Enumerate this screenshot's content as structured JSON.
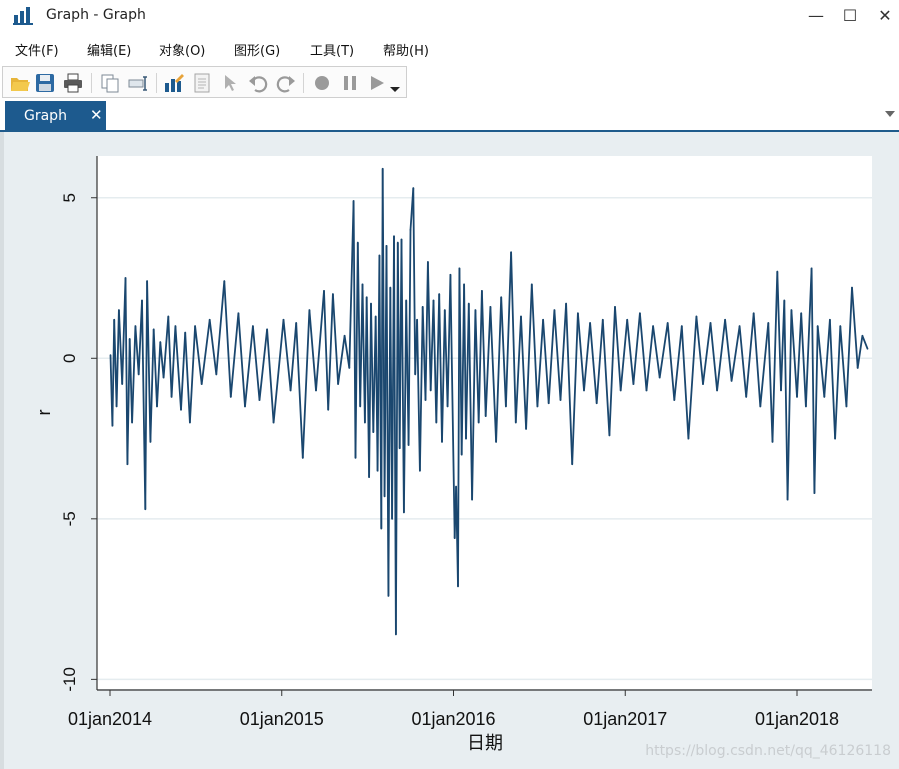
{
  "window": {
    "title": "Graph - Graph",
    "controls": {
      "minimize": "—",
      "maximize": "☐",
      "close": "✕"
    }
  },
  "menu": [
    "文件(F)",
    "编辑(E)",
    "对象(O)",
    "图形(G)",
    "工具(T)",
    "帮助(H)"
  ],
  "toolbar": {
    "icons": [
      "open-folder-icon",
      "save-icon",
      "print-icon",
      "copy-icon",
      "rename-icon",
      "graph-editor-icon",
      "document-icon",
      "pointer-icon",
      "undo-icon",
      "redo-icon",
      "record-icon",
      "pause-icon",
      "play-icon",
      "dropdown-icon"
    ]
  },
  "tab": {
    "label": "Graph",
    "close": "✕"
  },
  "watermark": "https://blog.csdn.net/qq_46126118",
  "colors": {
    "series": "#1a476f",
    "plot_bg": "#ffffff",
    "outer_bg": "#e8eef1",
    "tab_bg": "#1d5a8e",
    "grid": "#e5ecef"
  },
  "chart_data": {
    "type": "line",
    "xlabel": "日期",
    "ylabel": "r",
    "x_ticks": [
      "01jan2014",
      "01jan2015",
      "01jan2016",
      "01jan2017",
      "01jan2018"
    ],
    "y_ticks": [
      "-10",
      "-5",
      "0",
      "5"
    ],
    "ylim": [
      -10.3,
      6.3
    ],
    "x_range": [
      "2014-01-01",
      "2018-05-31"
    ],
    "grid": "horizontal",
    "series": [
      {
        "values": [
          {
            "x": "2014-01-02",
            "y": 0.1
          },
          {
            "x": "2014-01-06",
            "y": -2.1
          },
          {
            "x": "2014-01-10",
            "y": 1.2
          },
          {
            "x": "2014-01-15",
            "y": -1.5
          },
          {
            "x": "2014-01-20",
            "y": 1.5
          },
          {
            "x": "2014-01-27",
            "y": -0.8
          },
          {
            "x": "2014-02-03",
            "y": 2.5
          },
          {
            "x": "2014-02-07",
            "y": -3.3
          },
          {
            "x": "2014-02-12",
            "y": 0.6
          },
          {
            "x": "2014-02-17",
            "y": -2.0
          },
          {
            "x": "2014-02-24",
            "y": 1.0
          },
          {
            "x": "2014-03-03",
            "y": -0.5
          },
          {
            "x": "2014-03-10",
            "y": 1.8
          },
          {
            "x": "2014-03-17",
            "y": -4.7
          },
          {
            "x": "2014-03-21",
            "y": 2.4
          },
          {
            "x": "2014-03-28",
            "y": -2.6
          },
          {
            "x": "2014-04-04",
            "y": 0.9
          },
          {
            "x": "2014-04-11",
            "y": -1.5
          },
          {
            "x": "2014-04-18",
            "y": 0.5
          },
          {
            "x": "2014-04-25",
            "y": -0.6
          },
          {
            "x": "2014-05-05",
            "y": 1.3
          },
          {
            "x": "2014-05-12",
            "y": -1.2
          },
          {
            "x": "2014-05-20",
            "y": 1.0
          },
          {
            "x": "2014-06-01",
            "y": -1.6
          },
          {
            "x": "2014-06-10",
            "y": 0.8
          },
          {
            "x": "2014-06-20",
            "y": -2.0
          },
          {
            "x": "2014-07-01",
            "y": 1.0
          },
          {
            "x": "2014-07-15",
            "y": -0.8
          },
          {
            "x": "2014-08-01",
            "y": 1.2
          },
          {
            "x": "2014-08-15",
            "y": -0.5
          },
          {
            "x": "2014-09-01",
            "y": 2.4
          },
          {
            "x": "2014-09-15",
            "y": -1.2
          },
          {
            "x": "2014-10-01",
            "y": 1.4
          },
          {
            "x": "2014-10-15",
            "y": -1.5
          },
          {
            "x": "2014-11-01",
            "y": 1.0
          },
          {
            "x": "2014-11-15",
            "y": -1.3
          },
          {
            "x": "2014-12-01",
            "y": 0.9
          },
          {
            "x": "2014-12-15",
            "y": -2.0
          },
          {
            "x": "2015-01-05",
            "y": 1.2
          },
          {
            "x": "2015-01-20",
            "y": -1.0
          },
          {
            "x": "2015-02-01",
            "y": 1.1
          },
          {
            "x": "2015-02-15",
            "y": -3.1
          },
          {
            "x": "2015-03-01",
            "y": 1.5
          },
          {
            "x": "2015-03-15",
            "y": -1.0
          },
          {
            "x": "2015-04-01",
            "y": 2.1
          },
          {
            "x": "2015-04-10",
            "y": -1.6
          },
          {
            "x": "2015-04-20",
            "y": 2.0
          },
          {
            "x": "2015-05-01",
            "y": -0.8
          },
          {
            "x": "2015-05-15",
            "y": 0.7
          },
          {
            "x": "2015-05-25",
            "y": -0.3
          },
          {
            "x": "2015-06-03",
            "y": 4.9
          },
          {
            "x": "2015-06-07",
            "y": -3.1
          },
          {
            "x": "2015-06-12",
            "y": 3.6
          },
          {
            "x": "2015-06-17",
            "y": -1.5
          },
          {
            "x": "2015-06-22",
            "y": 2.3
          },
          {
            "x": "2015-06-27",
            "y": -2.0
          },
          {
            "x": "2015-07-01",
            "y": 1.9
          },
          {
            "x": "2015-07-06",
            "y": -3.7
          },
          {
            "x": "2015-07-10",
            "y": 1.7
          },
          {
            "x": "2015-07-15",
            "y": -2.3
          },
          {
            "x": "2015-07-20",
            "y": 1.3
          },
          {
            "x": "2015-07-24",
            "y": -3.5
          },
          {
            "x": "2015-07-28",
            "y": 3.2
          },
          {
            "x": "2015-08-01",
            "y": -5.3
          },
          {
            "x": "2015-08-04",
            "y": 5.9
          },
          {
            "x": "2015-08-08",
            "y": -4.3
          },
          {
            "x": "2015-08-12",
            "y": 3.5
          },
          {
            "x": "2015-08-16",
            "y": -7.4
          },
          {
            "x": "2015-08-20",
            "y": 2.2
          },
          {
            "x": "2015-08-24",
            "y": -5.0
          },
          {
            "x": "2015-08-28",
            "y": 3.8
          },
          {
            "x": "2015-09-01",
            "y": -8.6
          },
          {
            "x": "2015-09-05",
            "y": 3.6
          },
          {
            "x": "2015-09-09",
            "y": -2.8
          },
          {
            "x": "2015-09-13",
            "y": 3.7
          },
          {
            "x": "2015-09-18",
            "y": -4.8
          },
          {
            "x": "2015-09-23",
            "y": 1.8
          },
          {
            "x": "2015-09-28",
            "y": -2.7
          },
          {
            "x": "2015-10-02",
            "y": 4.0
          },
          {
            "x": "2015-10-08",
            "y": 5.3
          },
          {
            "x": "2015-10-12",
            "y": -0.5
          },
          {
            "x": "2015-10-16",
            "y": 1.2
          },
          {
            "x": "2015-10-22",
            "y": -3.5
          },
          {
            "x": "2015-10-28",
            "y": 1.6
          },
          {
            "x": "2015-11-03",
            "y": -1.3
          },
          {
            "x": "2015-11-08",
            "y": 3.0
          },
          {
            "x": "2015-11-14",
            "y": -1.0
          },
          {
            "x": "2015-11-20",
            "y": 1.8
          },
          {
            "x": "2015-11-26",
            "y": -2.0
          },
          {
            "x": "2015-12-02",
            "y": 2.0
          },
          {
            "x": "2015-12-08",
            "y": -2.6
          },
          {
            "x": "2015-12-14",
            "y": 1.5
          },
          {
            "x": "2015-12-20",
            "y": -1.5
          },
          {
            "x": "2015-12-26",
            "y": 2.6
          },
          {
            "x": "2016-01-04",
            "y": -5.6
          },
          {
            "x": "2016-01-07",
            "y": -4.0
          },
          {
            "x": "2016-01-11",
            "y": -7.1
          },
          {
            "x": "2016-01-14",
            "y": 2.8
          },
          {
            "x": "2016-01-19",
            "y": -3.0
          },
          {
            "x": "2016-01-24",
            "y": 2.3
          },
          {
            "x": "2016-01-28",
            "y": -2.5
          },
          {
            "x": "2016-02-03",
            "y": 1.7
          },
          {
            "x": "2016-02-10",
            "y": -4.4
          },
          {
            "x": "2016-02-17",
            "y": 1.5
          },
          {
            "x": "2016-02-24",
            "y": -2.0
          },
          {
            "x": "2016-03-02",
            "y": 2.1
          },
          {
            "x": "2016-03-10",
            "y": -1.8
          },
          {
            "x": "2016-03-20",
            "y": 1.6
          },
          {
            "x": "2016-04-01",
            "y": -2.6
          },
          {
            "x": "2016-04-12",
            "y": 1.9
          },
          {
            "x": "2016-04-22",
            "y": -1.5
          },
          {
            "x": "2016-05-03",
            "y": 3.3
          },
          {
            "x": "2016-05-13",
            "y": -2.0
          },
          {
            "x": "2016-05-24",
            "y": 1.3
          },
          {
            "x": "2016-06-04",
            "y": -2.2
          },
          {
            "x": "2016-06-16",
            "y": 2.3
          },
          {
            "x": "2016-06-28",
            "y": -1.5
          },
          {
            "x": "2016-07-10",
            "y": 1.2
          },
          {
            "x": "2016-07-22",
            "y": -1.4
          },
          {
            "x": "2016-08-03",
            "y": 1.5
          },
          {
            "x": "2016-08-16",
            "y": -1.3
          },
          {
            "x": "2016-08-28",
            "y": 1.7
          },
          {
            "x": "2016-09-10",
            "y": -3.3
          },
          {
            "x": "2016-09-22",
            "y": 1.4
          },
          {
            "x": "2016-10-05",
            "y": -1.0
          },
          {
            "x": "2016-10-18",
            "y": 1.1
          },
          {
            "x": "2016-11-01",
            "y": -1.4
          },
          {
            "x": "2016-11-14",
            "y": 1.2
          },
          {
            "x": "2016-11-28",
            "y": -2.4
          },
          {
            "x": "2016-12-10",
            "y": 1.6
          },
          {
            "x": "2016-12-22",
            "y": -1.0
          },
          {
            "x": "2017-01-05",
            "y": 1.2
          },
          {
            "x": "2017-01-18",
            "y": -0.8
          },
          {
            "x": "2017-02-01",
            "y": 1.4
          },
          {
            "x": "2017-02-15",
            "y": -1.0
          },
          {
            "x": "2017-03-01",
            "y": 1.0
          },
          {
            "x": "2017-03-15",
            "y": -0.6
          },
          {
            "x": "2017-04-01",
            "y": 1.1
          },
          {
            "x": "2017-04-15",
            "y": -1.3
          },
          {
            "x": "2017-05-01",
            "y": 1.0
          },
          {
            "x": "2017-05-15",
            "y": -2.5
          },
          {
            "x": "2017-06-01",
            "y": 1.3
          },
          {
            "x": "2017-06-15",
            "y": -0.8
          },
          {
            "x": "2017-07-01",
            "y": 1.1
          },
          {
            "x": "2017-07-15",
            "y": -1.0
          },
          {
            "x": "2017-08-01",
            "y": 1.2
          },
          {
            "x": "2017-08-15",
            "y": -0.7
          },
          {
            "x": "2017-09-01",
            "y": 1.0
          },
          {
            "x": "2017-09-15",
            "y": -1.2
          },
          {
            "x": "2017-10-01",
            "y": 1.4
          },
          {
            "x": "2017-10-15",
            "y": -1.5
          },
          {
            "x": "2017-11-01",
            "y": 1.1
          },
          {
            "x": "2017-11-10",
            "y": -2.6
          },
          {
            "x": "2017-11-20",
            "y": 2.7
          },
          {
            "x": "2017-11-28",
            "y": -1.0
          },
          {
            "x": "2017-12-05",
            "y": 1.8
          },
          {
            "x": "2017-12-12",
            "y": -4.4
          },
          {
            "x": "2017-12-20",
            "y": 1.5
          },
          {
            "x": "2018-01-01",
            "y": -1.2
          },
          {
            "x": "2018-01-10",
            "y": 1.4
          },
          {
            "x": "2018-01-20",
            "y": -1.5
          },
          {
            "x": "2018-02-01",
            "y": 2.8
          },
          {
            "x": "2018-02-07",
            "y": -4.2
          },
          {
            "x": "2018-02-14",
            "y": 1.0
          },
          {
            "x": "2018-02-28",
            "y": -1.2
          },
          {
            "x": "2018-03-12",
            "y": 1.2
          },
          {
            "x": "2018-03-23",
            "y": -2.5
          },
          {
            "x": "2018-04-03",
            "y": 1.0
          },
          {
            "x": "2018-04-16",
            "y": -1.5
          },
          {
            "x": "2018-04-28",
            "y": 2.2
          },
          {
            "x": "2018-05-10",
            "y": -0.3
          },
          {
            "x": "2018-05-20",
            "y": 0.7
          },
          {
            "x": "2018-05-31",
            "y": 0.3
          }
        ]
      }
    ]
  }
}
